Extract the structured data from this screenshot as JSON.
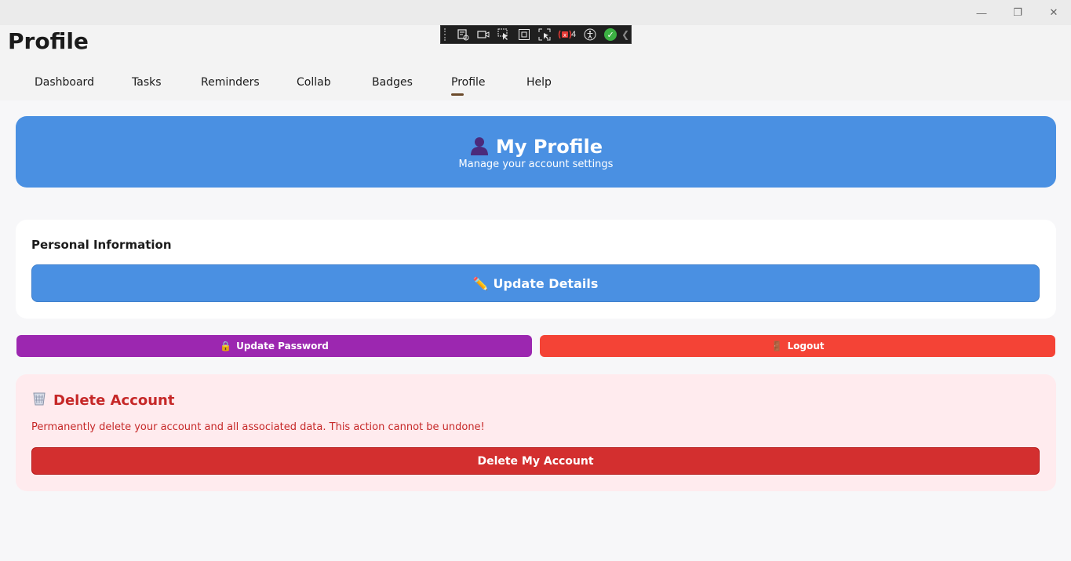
{
  "window": {
    "minimize_glyph": "—",
    "maximize_glyph": "❐",
    "close_glyph": "✕"
  },
  "header": {
    "title": "Profile"
  },
  "nav": {
    "tabs": [
      {
        "label": "Dashboard"
      },
      {
        "label": "Tasks"
      },
      {
        "label": "Reminders"
      },
      {
        "label": "Collab"
      },
      {
        "label": "Badges"
      },
      {
        "label": "Profile",
        "selected": true
      },
      {
        "label": "Help"
      }
    ]
  },
  "devtools": {
    "binding_errors_count": "4",
    "icons": [
      "live-visual-tree-icon",
      "record-icon",
      "select-element-icon",
      "display-layout-adorners-icon",
      "track-focus-icon",
      "binding-failures-icon",
      "accessibility-icon",
      "status-ok-icon",
      "collapse-chevron-icon"
    ]
  },
  "hero": {
    "icon": "person-silhouette-icon",
    "title": "My Profile",
    "subtitle": "Manage your account settings",
    "color": "#4a90e2"
  },
  "personal_info": {
    "heading": "Personal Information",
    "update_button_icon": "✏️",
    "update_button_label": "Update Details"
  },
  "actions": {
    "password_icon": "🔒",
    "password_label": "Update Password",
    "password_color": "#9c27b0",
    "logout_icon": "🚪",
    "logout_label": "Logout",
    "logout_color": "#f44336"
  },
  "danger_zone": {
    "icon": "wastebasket-icon",
    "title": "Delete Account",
    "description": "Permanently delete your account and all associated data. This action cannot be undone!",
    "button_label": "Delete My Account",
    "color": "#d32f2f"
  }
}
